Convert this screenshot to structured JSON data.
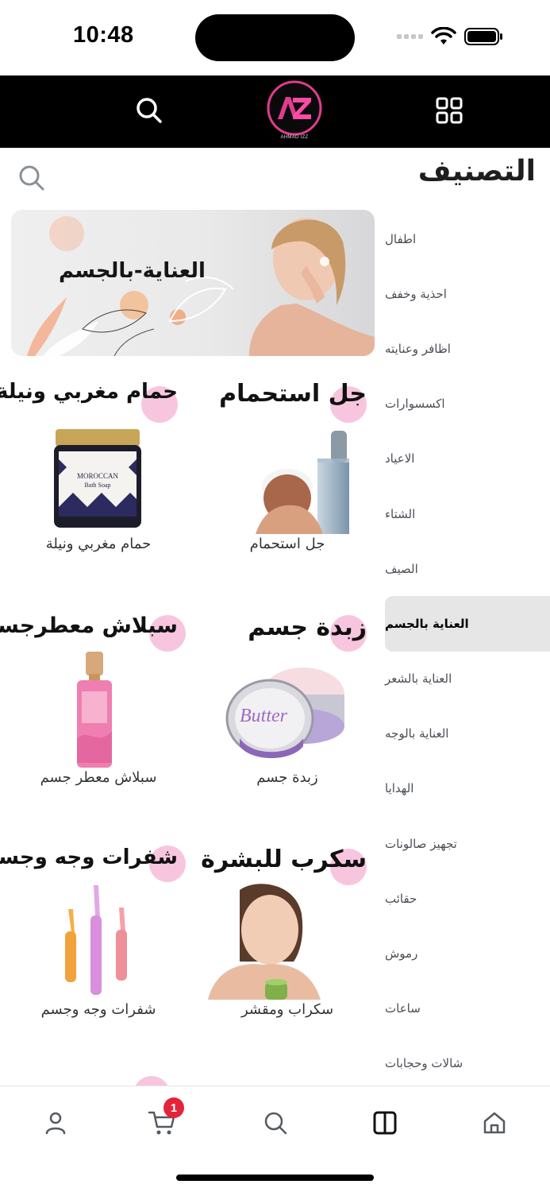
{
  "status_bar": {
    "time": "10:48"
  },
  "header": {
    "logo_text": "AZ",
    "logo_subtext": "AHMAD IZZ"
  },
  "page": {
    "title": "التصنيف"
  },
  "sidebar": {
    "items": [
      {
        "label": "اطفال"
      },
      {
        "label": "احذية وخفف"
      },
      {
        "label": "اظافر وعنايته"
      },
      {
        "label": "اكسسوارات"
      },
      {
        "label": "الاعياد"
      },
      {
        "label": "الشتاء"
      },
      {
        "label": "الصيف"
      },
      {
        "label": "العناية بالجسم",
        "active": true
      },
      {
        "label": "العناية بالشعر"
      },
      {
        "label": "العناية بالوجه"
      },
      {
        "label": "الهدايا"
      },
      {
        "label": "تجهيز صالونات"
      },
      {
        "label": "حقائب"
      },
      {
        "label": "رموش"
      },
      {
        "label": "ساعات"
      },
      {
        "label": "شالات وحجابات"
      }
    ]
  },
  "banner": {
    "text": "العناية-بالجسم"
  },
  "products": [
    {
      "title": "جل استحمام",
      "label": "جل استحمام"
    },
    {
      "title": "حمام مغربي ونيلة",
      "label": "حمام مغربي ونيلة"
    },
    {
      "title": "زبدة جسم",
      "label": "زبدة جسم"
    },
    {
      "title": "سبلاش معطرجسم",
      "label": "سبلاش معطر جسم"
    },
    {
      "title": "سكرب للبشرة",
      "label": "سكراب ومقشر"
    },
    {
      "title": "شفرات وجه وجسم",
      "label": "شفرات وجه وجسم"
    }
  ],
  "product_art": {
    "soap_jar_text": "MOROCCAN",
    "soap_jar_sub": "Bath Soap",
    "butter_text": "Butter"
  },
  "bottom_nav": {
    "cart_badge": "1"
  },
  "colors": {
    "accent_pink": "#f7c6de",
    "badge_red": "#e4233a",
    "header_bg": "#000000"
  }
}
